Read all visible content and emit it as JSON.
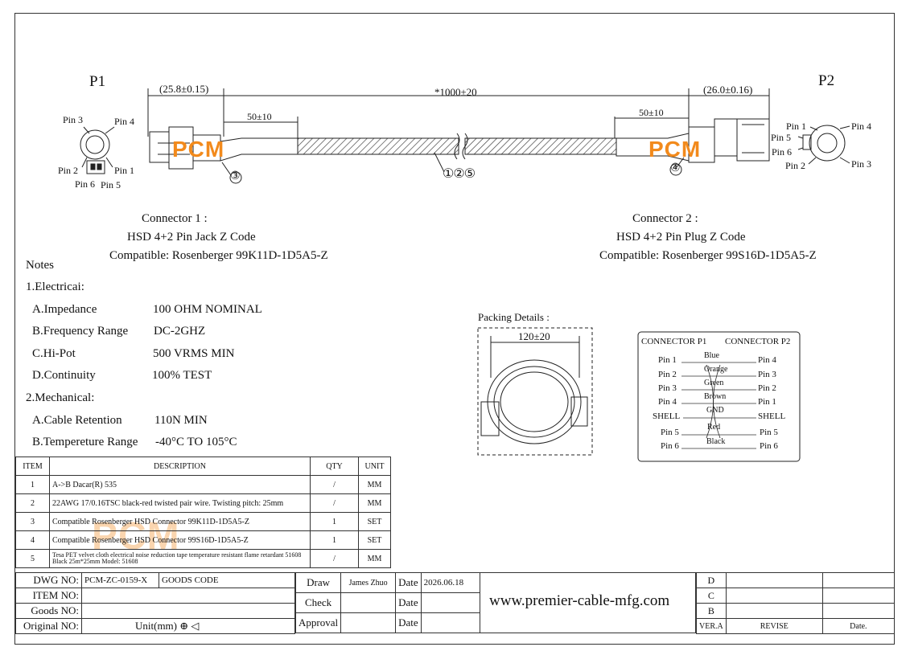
{
  "p1_label": "P1",
  "p2_label": "P2",
  "dims": {
    "p1_len": "(25.8±0.15)",
    "total": "*1000±20",
    "p2_len": "(26.0±0.16)",
    "left_strip": "50±10",
    "right_strip": "50±10"
  },
  "p1_pins": {
    "pin3": "Pin 3",
    "pin4": "Pin 4",
    "pin2": "Pin 2",
    "pin1": "Pin 1",
    "pin6": "Pin 6",
    "pin5": "Pin 5"
  },
  "p2_pins": {
    "pin1": "Pin 1",
    "pin4": "Pin 4",
    "pin5": "Pin 5",
    "pin6": "Pin 6",
    "pin2": "Pin 2",
    "pin3": "Pin 3"
  },
  "balloons": {
    "b3": "③",
    "b4": "④",
    "b125": "①②⑤"
  },
  "watermark": "PCM",
  "connector1": {
    "title": "Connector 1 :",
    "line1": "HSD 4+2 Pin Jack Z Code",
    "line2": "Compatible: Rosenberger 99K11D-1D5A5-Z"
  },
  "connector2": {
    "title": "Connector 2 :",
    "line1": "HSD  4+2 Pin Plug Z Code",
    "line2": "Compatible: Rosenberger 99S16D-1D5A5-Z"
  },
  "notes": {
    "title": "Notes",
    "electrical": "1.Electricai:",
    "impedance_k": "A.Impedance",
    "impedance_v": "100 OHM NOMINAL",
    "freq_k": "B.Frequency Range",
    "freq_v": "DC-2GHZ",
    "hipot_k": "C.Hi-Pot",
    "hipot_v": "500 VRMS MIN",
    "cont_k": "D.Continuity",
    "cont_v": "100% TEST",
    "mechanical": "2.Mechanical:",
    "ret_k": "A.Cable Retention",
    "ret_v": "110N MIN",
    "temp_k": "B.Tempereture Range",
    "temp_v": "-40°C TO 105°C"
  },
  "packing": {
    "title": "Packing Details :",
    "dim": "120±20"
  },
  "wiring": {
    "head_p1": "CONNECTOR P1",
    "head_p2": "CONNECTOR P2",
    "rows": [
      {
        "l": "Pin 1",
        "c": "Blue",
        "r": "Pin 4"
      },
      {
        "l": "Pin 2",
        "c": "Orange",
        "r": "Pin 3"
      },
      {
        "l": "Pin 3",
        "c": "Green",
        "r": "Pin 2"
      },
      {
        "l": "Pin 4",
        "c": "Brown",
        "r": "Pin 1"
      },
      {
        "l": "SHELL",
        "c": "GND",
        "r": "SHELL"
      },
      {
        "l": "Pin 5",
        "c": "Red",
        "r": "Pin 5"
      },
      {
        "l": "Pin 6",
        "c": "Black",
        "r": "Pin 6"
      }
    ]
  },
  "bom": {
    "h_item": "ITEM",
    "h_desc": "DESCRIPTION",
    "h_qty": "QTY",
    "h_unit": "UNIT",
    "rows": [
      {
        "item": "1",
        "desc": "A->B Dacar(R) 535",
        "qty": "/",
        "unit": "MM"
      },
      {
        "item": "2",
        "desc": "22AWG 17/0.16TSC black-red twisted pair wire. Twisting pitch: 25mm",
        "qty": "/",
        "unit": "MM"
      },
      {
        "item": "3",
        "desc": "Compatible Rosenberger HSD Connector 99K11D-1D5A5-Z",
        "qty": "1",
        "unit": "SET"
      },
      {
        "item": "4",
        "desc": "Compatible Rosenberger HSD Connector 99S16D-1D5A5-Z",
        "qty": "1",
        "unit": "SET"
      },
      {
        "item": "5",
        "desc": "Tesa PET velvet cloth electrical noise reduction tape temperature resistant flame retardant 51608 Black 25m*25mm Model: 51608",
        "qty": "/",
        "unit": "MM"
      }
    ]
  },
  "titleblock": {
    "dwg_k": "DWG NO:",
    "dwg_v": "PCM-ZC-0159-X",
    "goods_code": "GOODS CODE",
    "item_k": "ITEM NO:",
    "goods_k": "Goods NO:",
    "orig_k": "Original NO:",
    "unit": "Unit(mm)",
    "draw": "Draw",
    "drawer": "James Zhuo",
    "date": "Date",
    "date_v": "2026.06.18",
    "check": "Check",
    "approval": "Approval",
    "website": "www.premier-cable-mfg.com",
    "rev_d": "D",
    "rev_c": "C",
    "rev_b": "B",
    "vera": "VER.A",
    "revise": "REVISE",
    "rdate": "Date."
  }
}
